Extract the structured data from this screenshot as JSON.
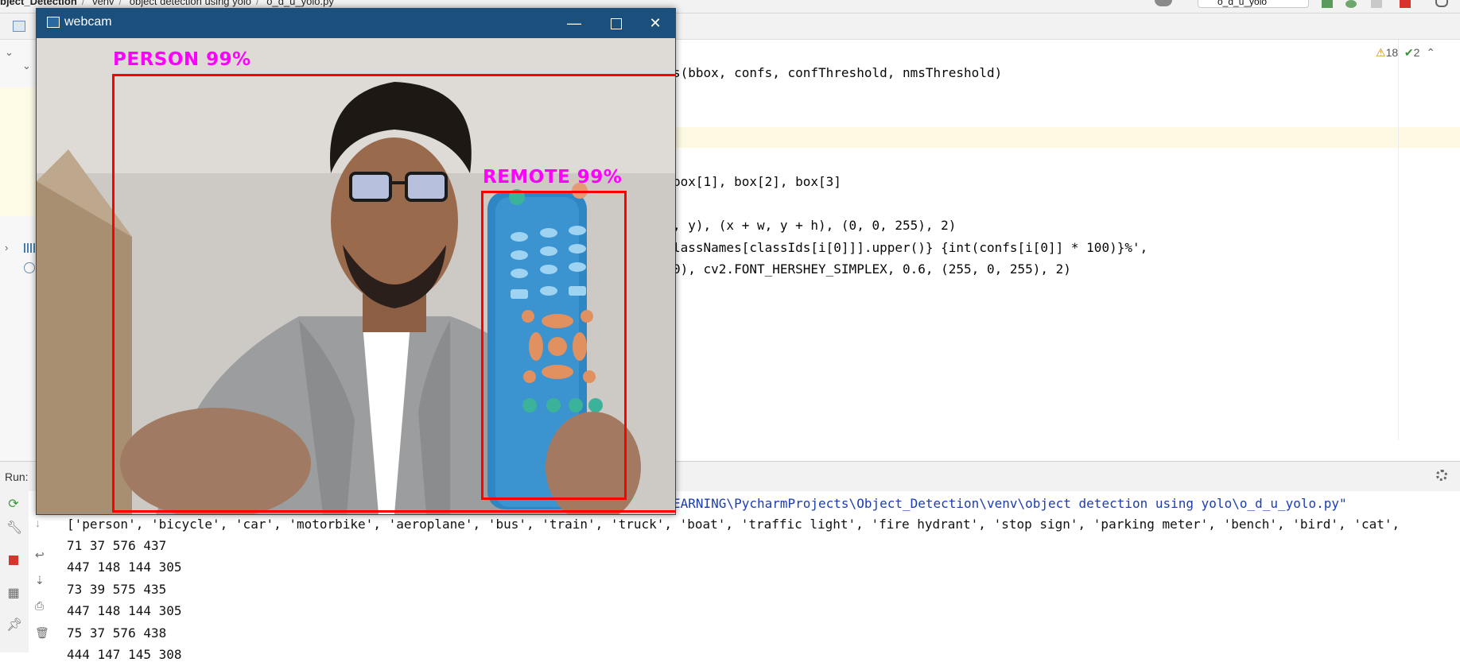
{
  "breadcrumbs": [
    "bject_Detection",
    "venv",
    "object detection using yolo",
    "o_d_u_yolo.py"
  ],
  "run_config": "o_d_u_yolo",
  "inspections": {
    "warnings": "18",
    "ok": "2"
  },
  "editor_lines": [
    "s(bbox, confs, confThreshold, nmsThreshold)",
    "box[1], box[2], box[3]",
    ", y), (x + w, y + h), (0, 0, 255), 2)",
    "lassNames[classIds[i[0]]].upper()} {int(confs[i[0]] * 100)}%',",
    "0), cv2.FONT_HERSHEY_SIMPLEX, 0.6, (255, 0, 255), 2)"
  ],
  "run": {
    "label": "Run:",
    "command_tail": "EARNING\\PycharmProjects\\Object_Detection\\venv\\object detection using yolo\\o_d_u_yolo.py\"",
    "class_list": "['person', 'bicycle', 'car', 'motorbike', 'aeroplane', 'bus', 'train', 'truck', 'boat', 'traffic light', 'fire hydrant', 'stop sign', 'parking meter', 'bench', 'bird', 'cat',",
    "output_lines": [
      "71 37 576 437",
      "447 148 144 305",
      "73 39 575 435",
      "447 148 144 305",
      "75 37 576 438",
      "444 147 145 308"
    ]
  },
  "webcam": {
    "title": "webcam",
    "detections": [
      {
        "label": "PERSON 99%",
        "color": "#ff00ff",
        "box_color": "#ff0000"
      },
      {
        "label": "REMOTE 99%",
        "color": "#ff00ff",
        "box_color": "#ff0000"
      }
    ]
  },
  "colors": {
    "accent_title": "#1b4f7c",
    "detection_text": "#ff00ff",
    "detection_box": "#ff0000"
  }
}
